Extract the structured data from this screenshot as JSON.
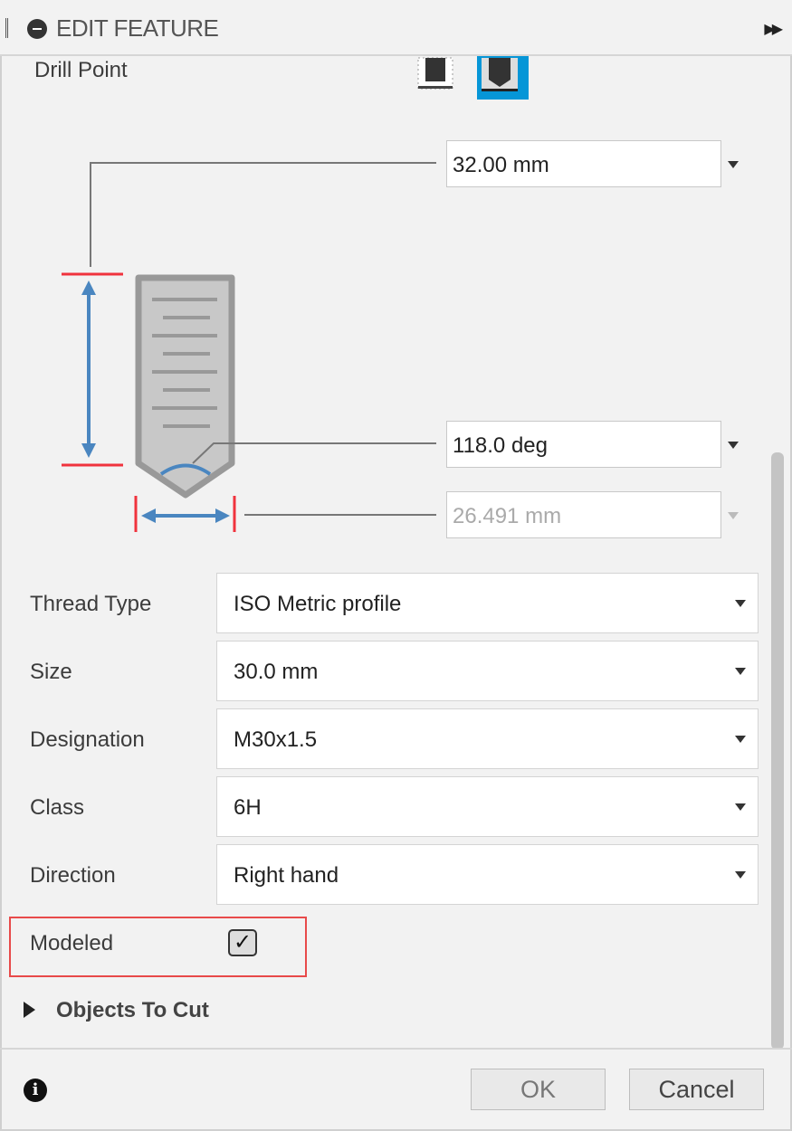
{
  "header": {
    "title": "EDIT FEATURE"
  },
  "drill_point": {
    "label": "Drill Point",
    "options": [
      "flat-drill-point-icon",
      "angled-drill-point-icon"
    ],
    "selected": 1,
    "accent": "#0696d7"
  },
  "dimensions": {
    "depth": "32.00 mm",
    "angle": "118.0 deg",
    "diameter": "26.491 mm"
  },
  "fields": [
    {
      "label": "Thread Type",
      "value": "ISO Metric profile"
    },
    {
      "label": "Size",
      "value": "30.0 mm"
    },
    {
      "label": "Designation",
      "value": "M30x1.5"
    },
    {
      "label": "Class",
      "value": "6H"
    },
    {
      "label": "Direction",
      "value": "Right hand"
    }
  ],
  "modeled": {
    "label": "Modeled",
    "checked": true,
    "mark": "✓"
  },
  "objects_to_cut": {
    "label": "Objects To Cut"
  },
  "footer": {
    "info": "i",
    "ok": "OK",
    "cancel": "Cancel"
  }
}
